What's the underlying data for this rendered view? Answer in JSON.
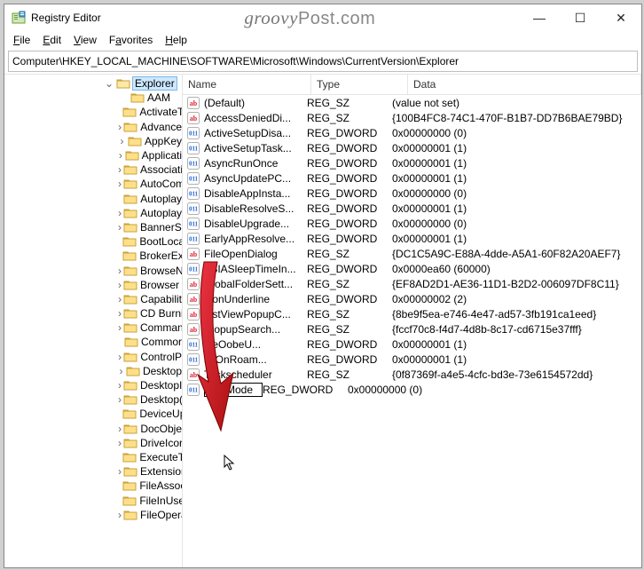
{
  "window": {
    "title": "Registry Editor",
    "watermark_a": "groovy",
    "watermark_b": "Post.com",
    "controls": {
      "minimize": "—",
      "maximize": "☐",
      "close": "✕"
    }
  },
  "menu": {
    "file": "File",
    "file_u": "F",
    "edit": "Edit",
    "edit_u": "E",
    "view": "View",
    "view_u": "V",
    "favorites": "Favorites",
    "favorites_u": "a",
    "help": "Help",
    "help_u": "H"
  },
  "address": "Computer\\HKEY_LOCAL_MACHINE\\SOFTWARE\\Microsoft\\Windows\\CurrentVersion\\Explorer",
  "tree": {
    "selected": "Explorer",
    "children": [
      {
        "label": "AAM",
        "exp": false
      },
      {
        "label": "ActivateT",
        "exp": false
      },
      {
        "label": "Advance",
        "exp": true
      },
      {
        "label": "AppKey",
        "exp": true
      },
      {
        "label": "Applicati",
        "exp": true
      },
      {
        "label": "Associati",
        "exp": true
      },
      {
        "label": "AutoCom",
        "exp": true
      },
      {
        "label": "Autoplay",
        "exp": false
      },
      {
        "label": "Autoplay",
        "exp": true
      },
      {
        "label": "BannerSt",
        "exp": true
      },
      {
        "label": "BootLoca",
        "exp": false
      },
      {
        "label": "BrokerExt",
        "exp": false
      },
      {
        "label": "BrowseN",
        "exp": true
      },
      {
        "label": "Browser I",
        "exp": true
      },
      {
        "label": "Capabilit",
        "exp": true
      },
      {
        "label": "CD Burni",
        "exp": true
      },
      {
        "label": "Comman",
        "exp": true
      },
      {
        "label": "Commor",
        "exp": false
      },
      {
        "label": "ControlP",
        "exp": true
      },
      {
        "label": "Desktop",
        "exp": true
      },
      {
        "label": "DesktopI",
        "exp": true
      },
      {
        "label": "Desktop(",
        "exp": true
      },
      {
        "label": "DeviceUp",
        "exp": false
      },
      {
        "label": "DocObje",
        "exp": true
      },
      {
        "label": "DriveIcor",
        "exp": true
      },
      {
        "label": "ExecuteTy",
        "exp": false
      },
      {
        "label": "Extension",
        "exp": true
      },
      {
        "label": "FileAssoc",
        "exp": false
      },
      {
        "label": "FileInUse",
        "exp": false
      },
      {
        "label": "FileOpera",
        "exp": true
      }
    ]
  },
  "columns": {
    "name": "Name",
    "type": "Type",
    "data": "Data"
  },
  "values": [
    {
      "icon": "sz",
      "name": "(Default)",
      "type": "REG_SZ",
      "data": "(value not set)"
    },
    {
      "icon": "sz",
      "name": "AccessDeniedDi...",
      "type": "REG_SZ",
      "data": "{100B4FC8-74C1-470F-B1B7-DD7B6BAE79BD}"
    },
    {
      "icon": "dw",
      "name": "ActiveSetupDisa...",
      "type": "REG_DWORD",
      "data": "0x00000000 (0)"
    },
    {
      "icon": "dw",
      "name": "ActiveSetupTask...",
      "type": "REG_DWORD",
      "data": "0x00000001 (1)"
    },
    {
      "icon": "dw",
      "name": "AsyncRunOnce",
      "type": "REG_DWORD",
      "data": "0x00000001 (1)"
    },
    {
      "icon": "dw",
      "name": "AsyncUpdatePC...",
      "type": "REG_DWORD",
      "data": "0x00000001 (1)"
    },
    {
      "icon": "dw",
      "name": "DisableAppInsta...",
      "type": "REG_DWORD",
      "data": "0x00000000 (0)"
    },
    {
      "icon": "dw",
      "name": "DisableResolveS...",
      "type": "REG_DWORD",
      "data": "0x00000001 (1)"
    },
    {
      "icon": "dw",
      "name": "DisableUpgrade...",
      "type": "REG_DWORD",
      "data": "0x00000000 (0)"
    },
    {
      "icon": "dw",
      "name": "EarlyAppResolve...",
      "type": "REG_DWORD",
      "data": "0x00000001 (1)"
    },
    {
      "icon": "sz",
      "name": "FileOpenDialog",
      "type": "REG_SZ",
      "data": "{DC1C5A9C-E88A-4dde-A5A1-60F82A20AEF7}"
    },
    {
      "icon": "dw",
      "name": "FSIASleepTimeIn...",
      "type": "REG_DWORD",
      "data": "0x0000ea60 (60000)"
    },
    {
      "icon": "sz",
      "name": "GlobalFolderSett...",
      "type": "REG_SZ",
      "data": "{EF8AD2D1-AE36-11D1-B2D2-006097DF8C11}"
    },
    {
      "icon": "sz",
      "name": "IconUnderline",
      "type": "REG_DWORD",
      "data": "0x00000002 (2)"
    },
    {
      "icon": "sz",
      "name": "ListViewPopupC...",
      "type": "REG_SZ",
      "data": "{8be9f5ea-e746-4e47-ad57-3fb191ca1eed}"
    },
    {
      "icon": "sz",
      "name": "/PopupSearch...",
      "type": "REG_SZ",
      "data": "{fccf70c8-f4d7-4d8b-8c17-cd6715e37fff}"
    },
    {
      "icon": "dw",
      "name": "ineOobeU...",
      "type": "REG_DWORD",
      "data": "0x00000001 (1)"
    },
    {
      "icon": "dw",
      "name": "aitOnRoam...",
      "type": "REG_DWORD",
      "data": "0x00000001 (1)"
    },
    {
      "icon": "sz",
      "name": "Taskscheduler",
      "type": "REG_SZ",
      "data": "{0f87369f-a4e5-4cfc-bd3e-73e6154572dd}"
    },
    {
      "icon": "dw",
      "name": "HubMode",
      "type": "REG_DWORD",
      "data": "0x00000000 (0)",
      "editing": true
    }
  ]
}
